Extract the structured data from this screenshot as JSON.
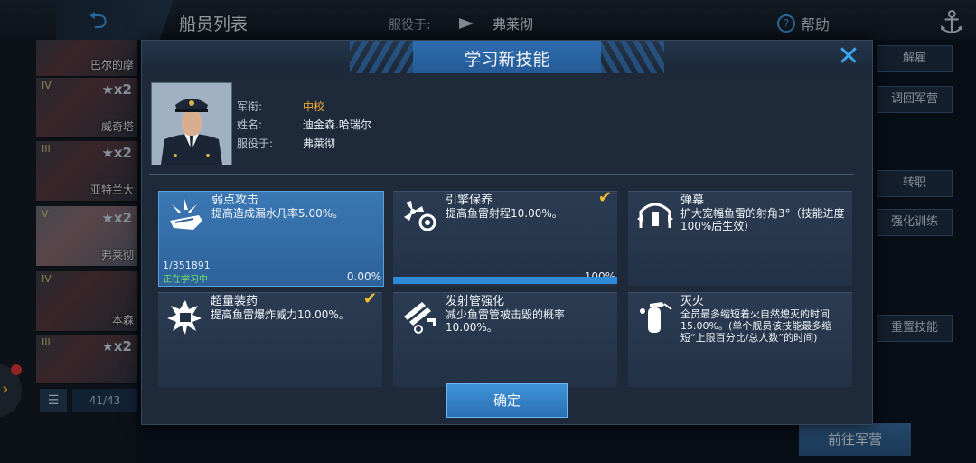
{
  "background": {
    "title": "船员列表",
    "serving_label": "服役于:",
    "ship": "弗莱彻",
    "help": "帮助",
    "crew": [
      {
        "level": "",
        "mult": "",
        "name": "巴尔的摩"
      },
      {
        "level": "IV",
        "mult": "★x2",
        "name": "威奇塔"
      },
      {
        "level": "III",
        "mult": "★x2",
        "name": "亚特兰大"
      },
      {
        "level": "V",
        "mult": "★x2",
        "name": "弗莱彻"
      },
      {
        "level": "IV",
        "mult": "",
        "name": "本森"
      },
      {
        "level": "III",
        "mult": "★x2",
        "name": ""
      }
    ],
    "count": "41/43",
    "right_buttons": [
      "解雇",
      "调回军营",
      "转职",
      "强化训练",
      "重置技能"
    ],
    "bottom_button": "前往军营"
  },
  "modal": {
    "title": "学习新技能",
    "info": {
      "rank_label": "军衔:",
      "rank": "中校",
      "name_label": "姓名:",
      "name": "迪金森.哈瑞尔",
      "serve_label": "服役于:",
      "ship": "弗莱彻"
    },
    "skills": [
      {
        "name": "弱点攻击",
        "desc": "提高造成漏水几率5.00%。",
        "exp": "1/351891",
        "status": "正在学习中",
        "progress_label": "0.00%",
        "progress": 0.0,
        "icon": "weakpoint-icon",
        "checked": false
      },
      {
        "name": "引擎保养",
        "desc": "提高鱼雷射程10.00%。",
        "progress_label": "100%",
        "progress": 1.0,
        "icon": "engine-icon",
        "checked": true
      },
      {
        "name": "弹幕",
        "desc": "扩大宽幅鱼雷的射角3°（技能进度100%后生效）",
        "icon": "barrage-icon",
        "checked": false
      },
      {
        "name": "超量装药",
        "desc": "提高鱼雷爆炸威力10.00%。",
        "icon": "overcharge-icon",
        "checked": true
      },
      {
        "name": "发射管强化",
        "desc": "减少鱼雷管被击毁的概率10.00%。",
        "icon": "tube-icon",
        "checked": false
      },
      {
        "name": "灭火",
        "desc": "全员最多缩短着火自然熄灭的时间15.00%。(单个舰员该技能最多缩短“上限百分比/总人数”的时间)",
        "icon": "extinguisher-icon",
        "checked": false
      }
    ],
    "confirm": "确定"
  },
  "colors": {
    "accent": "#3aa6f0",
    "check": "#f0c030",
    "rank": "#f0a830",
    "learning": "#6fe06f"
  }
}
